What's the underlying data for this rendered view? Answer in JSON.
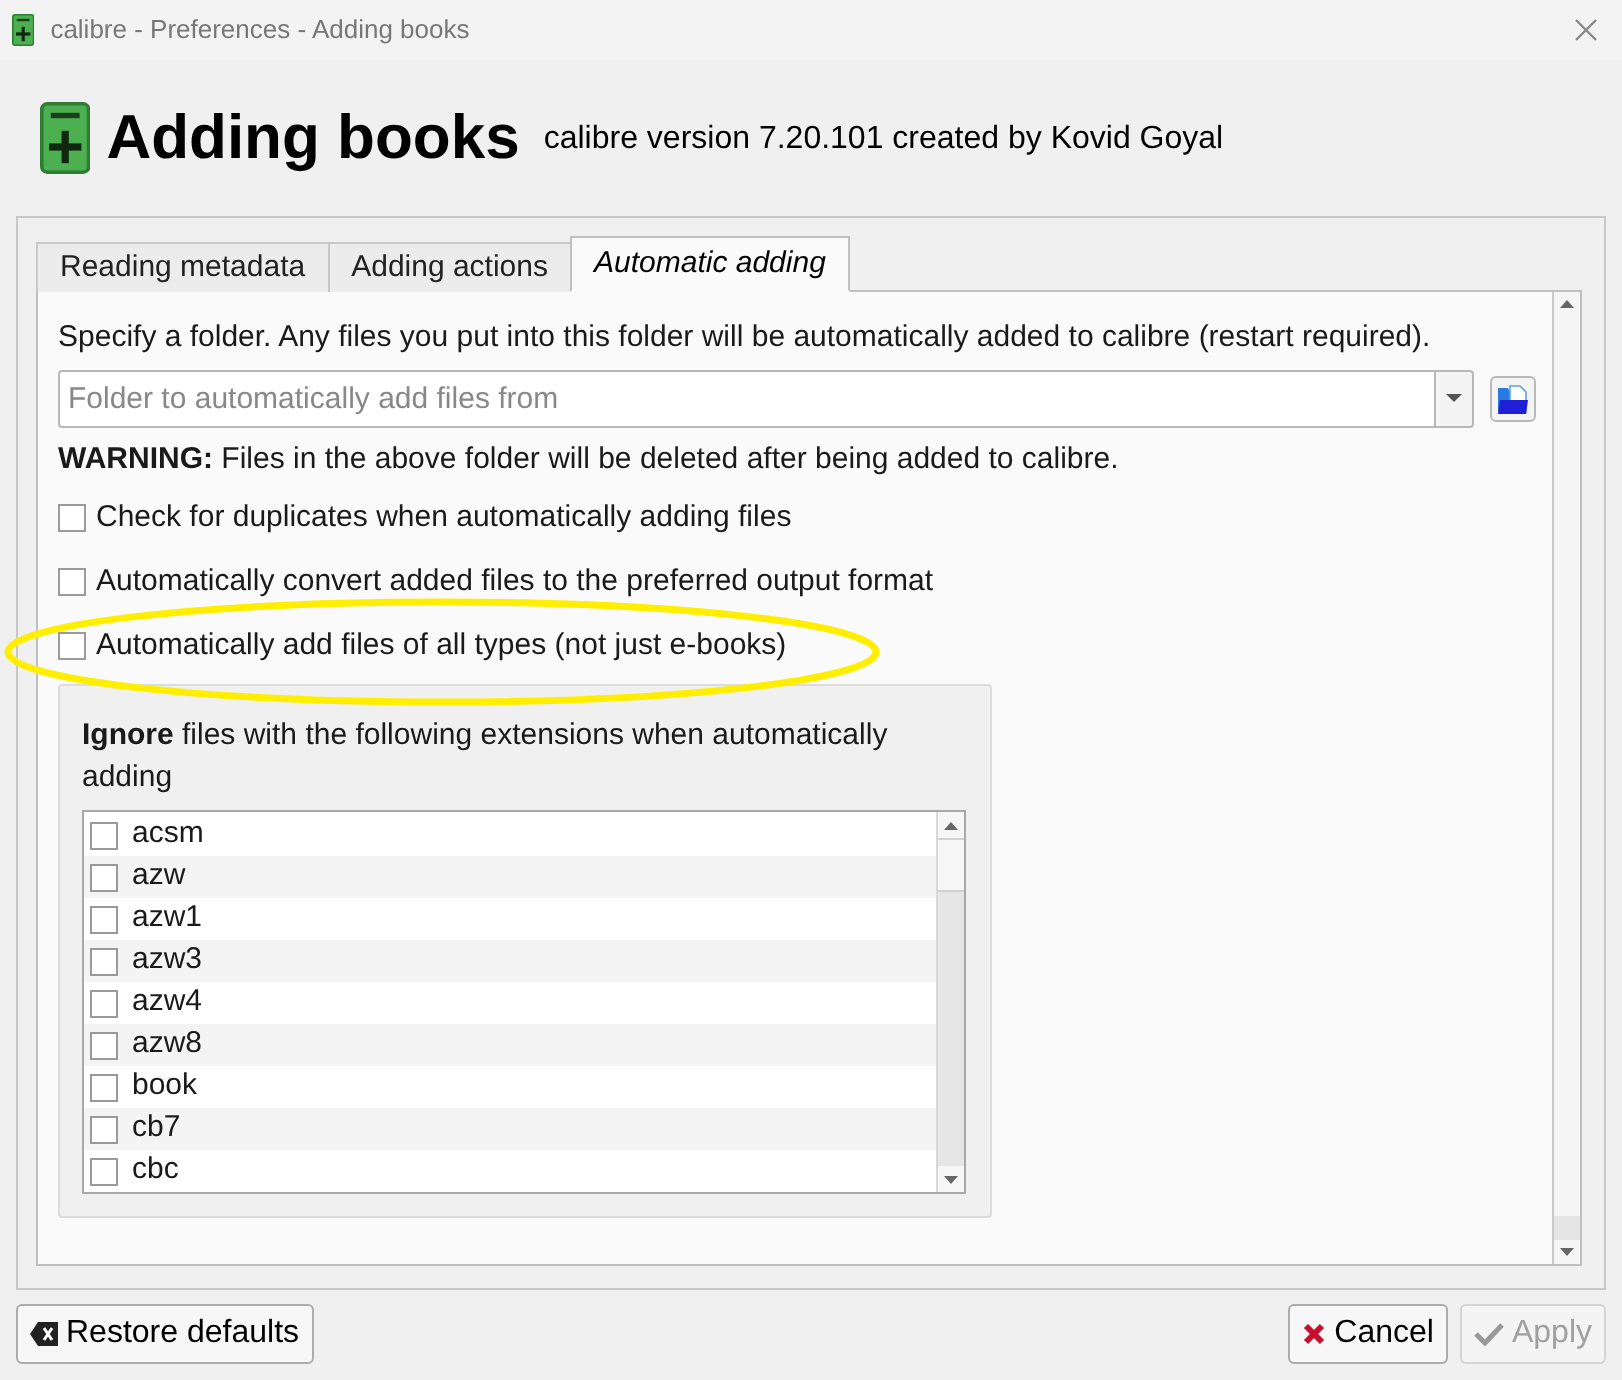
{
  "window": {
    "title": "calibre - Preferences - Adding books"
  },
  "header": {
    "title": "Adding books",
    "subtitle": "calibre version 7.20.101 created by Kovid Goyal"
  },
  "tabs": [
    {
      "label": "Reading metadata",
      "selected": false
    },
    {
      "label": "Adding actions",
      "selected": false
    },
    {
      "label": "Automatic adding",
      "selected": true
    }
  ],
  "panel": {
    "intro": "Specify a folder. Any files you put into this folder will be automatically added to calibre (restart required).",
    "folder_field": {
      "placeholder": "Folder to automatically add files from"
    },
    "warning": "**WARNING:** Files in the above folder will be deleted after being added to calibre.",
    "options": [
      {
        "label": "Check for duplicates when automatically adding files",
        "checked": false,
        "highlighted": false
      },
      {
        "label": "Automatically convert added files to the preferred output format",
        "checked": false,
        "highlighted": false
      },
      {
        "label": "Automatically add files of all types (not just e-books)",
        "checked": false,
        "highlighted": true
      }
    ],
    "ignore_group": {
      "caption": "**Ignore** files with the following extensions when automatically adding",
      "extensions": [
        {
          "label": "acsm",
          "checked": false
        },
        {
          "label": "azw",
          "checked": false
        },
        {
          "label": "azw1",
          "checked": false
        },
        {
          "label": "azw3",
          "checked": false
        },
        {
          "label": "azw4",
          "checked": false
        },
        {
          "label": "azw8",
          "checked": false
        },
        {
          "label": "book",
          "checked": false
        },
        {
          "label": "cb7",
          "checked": false
        },
        {
          "label": "cbc",
          "checked": false
        }
      ]
    }
  },
  "buttons": [
    {
      "label": "Restore defaults",
      "kind": "restore",
      "disabled": false
    },
    {
      "label": "Cancel",
      "kind": "cancel",
      "disabled": false
    },
    {
      "label": "Apply",
      "kind": "apply",
      "disabled": true
    }
  ]
}
